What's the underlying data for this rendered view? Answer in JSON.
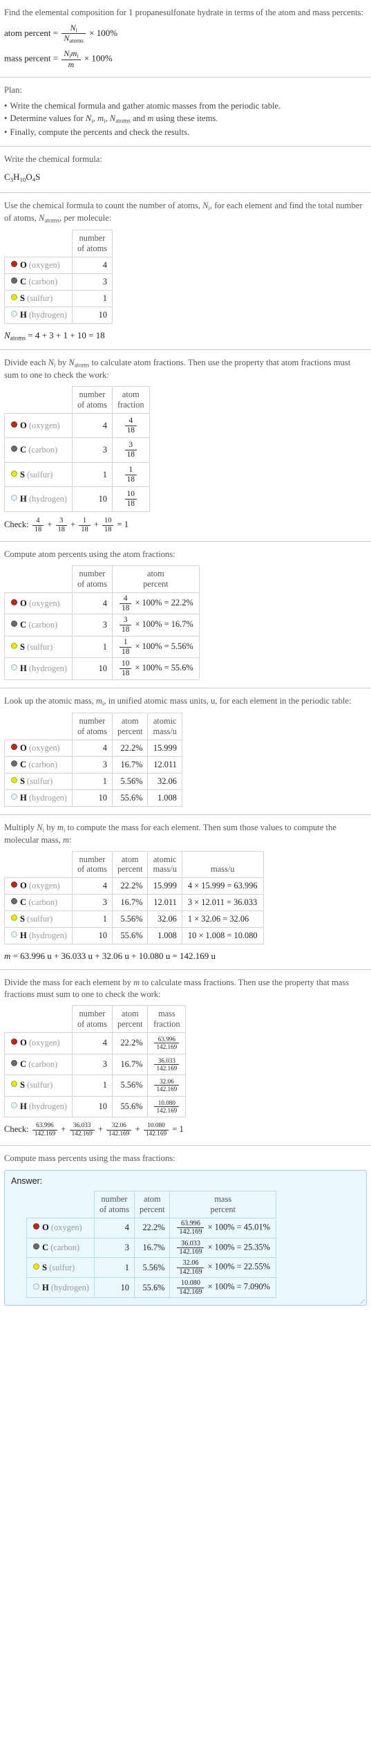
{
  "intro": {
    "prompt": "Find the elemental composition for 1 propanesulfonate hydrate in terms of the atom and mass percents:",
    "atom_percent_label": "atom percent",
    "mass_percent_label": "mass percent",
    "times_100": "× 100%"
  },
  "plan": {
    "title": "Plan:",
    "bullets": [
      "Write the chemical formula and gather atomic masses from the periodic table.",
      "Finally, compute the percents and check the results."
    ],
    "bullet2_pre": "Determine values for ",
    "bullet2_post": " using these items."
  },
  "formula_step": {
    "instruction": "Write the chemical formula:",
    "formula_parts": [
      {
        "sym": "C",
        "sub": "3"
      },
      {
        "sym": "H",
        "sub": "10"
      },
      {
        "sym": "O",
        "sub": "4"
      },
      {
        "sym": "S",
        "sub": ""
      }
    ]
  },
  "count_step": {
    "instruction_a": "Use the chemical formula to count the number of atoms, ",
    "instruction_b": ", for each element and find the total number of atoms, ",
    "instruction_c": ", per molecule:",
    "header_number_of_atoms": [
      "number",
      "of atoms"
    ],
    "total_line": "= 4 + 3 + 1 + 10 = 18"
  },
  "elements": [
    {
      "symbol": "O",
      "name": "(oxygen)",
      "color": "#c1271c",
      "count": "4",
      "atom_fraction_num": "4",
      "atom_fraction_den": "18",
      "atom_percent": "22.2%",
      "atomic_mass": "15.999",
      "mass_expr": "4 × 15.999 = 63.996",
      "mass_num": "63.996",
      "mass_den": "142.169",
      "mass_percent": "45.01%"
    },
    {
      "symbol": "C",
      "name": "(carbon)",
      "color": "#6b6b6b",
      "count": "3",
      "atom_fraction_num": "3",
      "atom_fraction_den": "18",
      "atom_percent": "16.7%",
      "atomic_mass": "12.011",
      "mass_expr": "3 × 12.011 = 36.033",
      "mass_num": "36.033",
      "mass_den": "142.169",
      "mass_percent": "25.35%"
    },
    {
      "symbol": "S",
      "name": "(sulfur)",
      "color": "#e8e80f",
      "count": "1",
      "atom_fraction_num": "1",
      "atom_fraction_den": "18",
      "atom_percent": "5.56%",
      "atomic_mass": "32.06",
      "mass_expr": "1 × 32.06 = 32.06",
      "mass_num": "32.06",
      "mass_den": "142.169",
      "mass_percent": "22.55%"
    },
    {
      "symbol": "H",
      "name": "(hydrogen)",
      "color": "#e4f4f7",
      "count": "10",
      "atom_fraction_num": "10",
      "atom_fraction_den": "18",
      "atom_percent": "55.6%",
      "atomic_mass": "1.008",
      "mass_expr": "10 × 1.008 = 10.080",
      "mass_num": "10.080",
      "mass_den": "142.169",
      "mass_percent": "7.090%"
    }
  ],
  "atom_fraction_step": {
    "instruction_a": "Divide each ",
    "instruction_b": " by ",
    "instruction_c": " to calculate atom fractions. Then use the property that atom fractions must sum to one to check the work:",
    "header_atom_fraction": [
      "atom",
      "fraction"
    ],
    "check_label": "Check:",
    "check_result": "= 1"
  },
  "atom_percent_step": {
    "instruction": "Compute atom percents using the atom fractions:",
    "header_atom_percent": [
      "atom",
      "percent"
    ],
    "times_100": "× 100% ="
  },
  "atomic_mass_step": {
    "instruction_a": "Look up the atomic mass, ",
    "instruction_b": ", in unified atomic mass units, u, for each element in the periodic table:",
    "header_atomic_mass": [
      "atomic",
      "mass/u"
    ]
  },
  "molecular_mass_step": {
    "instruction_a": "Multiply ",
    "instruction_b": " by ",
    "instruction_c": " to compute the mass for each element. Then sum those values to compute the molecular mass, ",
    "instruction_d": ":",
    "header_mass": [
      "",
      "mass/u"
    ],
    "sum_line": "= 63.996 u + 36.033 u + 32.06 u + 10.080 u = 142.169 u"
  },
  "mass_fraction_step": {
    "instruction_a": "Divide the mass for each element by ",
    "instruction_b": " to calculate mass fractions. Then use the property that mass fractions must sum to one to check the work:",
    "header_mass_fraction": [
      "mass",
      "fraction"
    ],
    "check_label": "Check:",
    "check_result": "= 1"
  },
  "mass_percent_step": {
    "instruction": "Compute mass percents using the mass fractions:",
    "answer_label": "Answer:",
    "header_mass_percent": [
      "mass",
      "percent"
    ],
    "times_100": "× 100% ="
  },
  "common_headers": {
    "number_of_atoms": [
      "number",
      "of atoms"
    ],
    "atom_percent": [
      "atom",
      "percent"
    ]
  }
}
